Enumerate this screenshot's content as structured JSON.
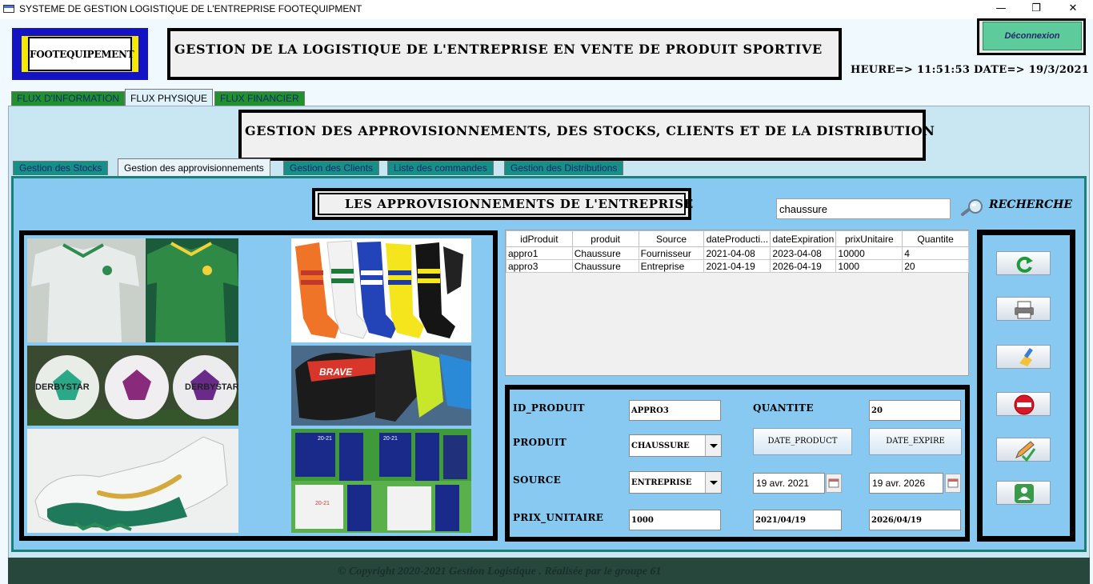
{
  "window": {
    "title": "SYSTEME DE GESTION LOGISTIQUE DE L'ENTREPRISE FOOTEQUIPMENT",
    "minimize": "—",
    "maximize": "❐",
    "close": "✕"
  },
  "header": {
    "logo_text": "FOOTEQUIPEMENT",
    "title": "GESTION DE LA LOGISTIQUE DE L'ENTREPRISE EN VENTE DE PRODUIT SPORTIVE",
    "logout_label": "Déconnexion",
    "clock": "HEURE=> 11:51:53  DATE=> 19/3/2021"
  },
  "main_tabs": [
    {
      "label": "FLUX D'INFORMATION"
    },
    {
      "label": "FLUX PHYSIQUE"
    },
    {
      "label": "FLUX FINANCIER"
    }
  ],
  "section_title": "GESTION DES APPROVISIONNEMENTS, DES STOCKS, CLIENTS  ET DE LA DISTRIBUTION",
  "sub_tabs": [
    {
      "label": "Gestion des Stocks"
    },
    {
      "label": "Gestion des approvisionnements"
    },
    {
      "label": "Gestion des Clients"
    },
    {
      "label": "Liste des commandes"
    },
    {
      "label": "Gestion des Distributions"
    }
  ],
  "panel": {
    "title": "LES  APPROVISIONNEMENTS   DE L'ENTREPRISE",
    "search_value": "chaussure",
    "search_label": "RECHERCHE"
  },
  "table": {
    "columns": [
      "idProduit",
      "produit",
      "Source",
      "dateProducti...",
      "dateExpiration",
      "prixUnitaire",
      "Quantite"
    ],
    "rows": [
      [
        "appro1",
        "Chaussure",
        "Fournisseur",
        "2021-04-08",
        "2023-04-08",
        "10000",
        "4"
      ],
      [
        "appro3",
        "Chaussure",
        "Entreprise",
        "2021-04-19",
        "2026-04-19",
        "1000",
        "20"
      ]
    ]
  },
  "form": {
    "id_label": "ID_PRODUIT",
    "id_value": "APPRO3",
    "qty_label": "QUANTITE",
    "qty_value": "20",
    "product_label": "PRODUIT",
    "product_value": "CHAUSSURE",
    "date_product_btn": "DATE_PRODUCT",
    "date_expire_btn": "DATE_EXPIRE",
    "source_label": "SOURCE",
    "source_value": "ENTREPRISE",
    "date_prod_picker": "19 avr. 2021",
    "date_exp_picker": "19 avr. 2026",
    "price_label": "PRIX_UNITAIRE",
    "price_value": "1000",
    "date_prod_text": "2021/04/19",
    "date_exp_text": "2026/04/19"
  },
  "photos": {
    "ball_brand": "DERBYSTAR",
    "glove_brand": "BRAVE",
    "kit_badge": "20-21"
  },
  "footer": {
    "copyright": "© Copyright 2020-2021 Gestion Logistique . Réalisée par le groupe 61"
  }
}
